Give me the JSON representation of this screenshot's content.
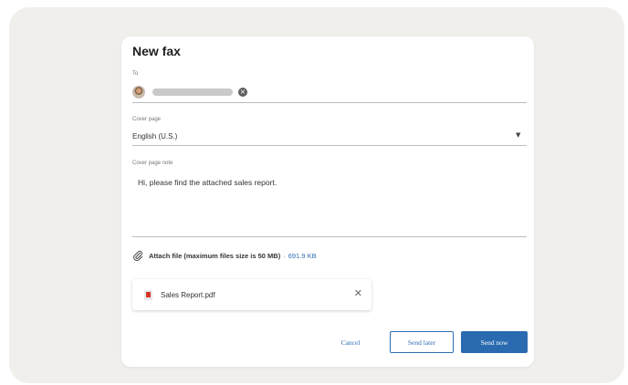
{
  "dialog": {
    "title": "New fax",
    "to": {
      "label": "To",
      "remove_icon": "close-icon"
    },
    "cover_page": {
      "label": "Cover page",
      "selected": "English (U.S.)",
      "arrow_icon": "caret-down-icon"
    },
    "cover_page_note": {
      "label": "Cover page note",
      "value": "Hi, please find the attached sales report."
    },
    "attach": {
      "icon": "paperclip-icon",
      "label": "Attach file (maximum files size is 50 MB)",
      "separator": "·",
      "size": "691.9 KB"
    },
    "attachment": {
      "icon": "pdf-icon",
      "name": "Sales Report.pdf",
      "remove_icon": "close-icon"
    },
    "buttons": {
      "cancel": "Cancel",
      "send_later": "Send later",
      "send_now": "Send now"
    }
  },
  "colors": {
    "accent": "#2a6ab0",
    "link": "#2f6fb3",
    "background": "#f0efeb"
  }
}
